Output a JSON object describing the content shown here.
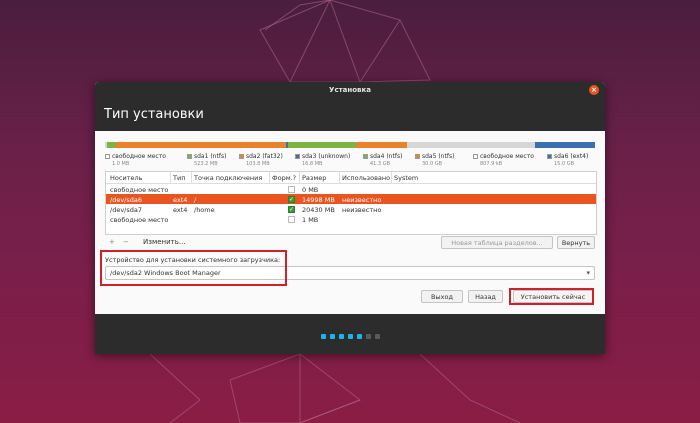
{
  "window": {
    "title": "Установка",
    "close_glyph": "×",
    "heading": "Тип установки"
  },
  "partition_bar": [
    {
      "color": "#d6d6d6",
      "weight": 0.5
    },
    {
      "color": "#7cb342",
      "weight": 2
    },
    {
      "color": "#e9832b",
      "weight": 40
    },
    {
      "color": "#3c6fb0",
      "weight": 0.5
    },
    {
      "color": "#7cb342",
      "weight": 16
    },
    {
      "color": "#e9832b",
      "weight": 12
    },
    {
      "color": "#d6d6d6",
      "weight": 30
    },
    {
      "color": "#3c6fb0",
      "weight": 14
    }
  ],
  "legend": [
    {
      "label": "свободное место",
      "size": "1.0 MB",
      "color": "#ffffff"
    },
    {
      "label": "sda1 (ntfs)",
      "size": "523.2 MB",
      "color": "#7cb342"
    },
    {
      "label": "sda2 (fat32)",
      "size": "103.8 MB",
      "color": "#e9832b"
    },
    {
      "label": "sda3 (unknown)",
      "size": "16.8 MB",
      "color": "#3c6fb0"
    },
    {
      "label": "sda4 (ntfs)",
      "size": "41.3 GB",
      "color": "#7cb342"
    },
    {
      "label": "sda5 (ntfs)",
      "size": "30.0 GB",
      "color": "#e9832b"
    },
    {
      "label": "свободное место",
      "size": "807.9 kB",
      "color": "#ffffff"
    },
    {
      "label": "sda6 (ext4)",
      "size": "15.0 GB",
      "color": "#3c6fb0"
    }
  ],
  "table": {
    "headers": [
      "Носитель",
      "Тип",
      "Точка подключения",
      "Форм.?",
      "Размер",
      "Использовано",
      "System"
    ],
    "rows": [
      {
        "device": "свободное место",
        "type": "",
        "mount": "",
        "format": false,
        "size": "0 MB",
        "used": "",
        "selected": false
      },
      {
        "device": "/dev/sda6",
        "type": "ext4",
        "mount": "/",
        "format": true,
        "size": "14998 MB",
        "used": "неизвестно",
        "selected": true
      },
      {
        "device": "/dev/sda7",
        "type": "ext4",
        "mount": "/home",
        "format": true,
        "size": "20430 MB",
        "used": "неизвестно",
        "selected": false
      },
      {
        "device": "свободное место",
        "type": "",
        "mount": "",
        "format": false,
        "size": "1 MB",
        "used": "",
        "selected": false
      }
    ]
  },
  "toolbar": {
    "add": "+",
    "remove": "−",
    "change": "Изменить...",
    "new_table": "Новая таблица разделов...",
    "revert": "Вернуть"
  },
  "boot": {
    "label": "Устройство для установки системного загрузчика:",
    "value": "/dev/sda2 Windows Boot Manager",
    "arrow": "▾"
  },
  "buttons": {
    "quit": "Выход",
    "back": "Назад",
    "install": "Установить сейчас"
  },
  "progress": {
    "total": 7,
    "active": 5,
    "active_color": "#19b6ee",
    "inactive_color": "#5a5a5a"
  },
  "accent": "#e95420"
}
